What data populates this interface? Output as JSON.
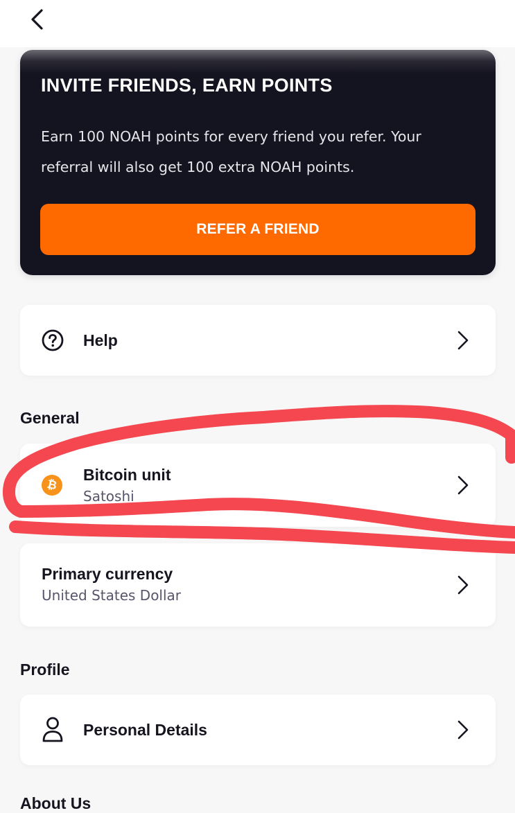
{
  "header": {
    "back_icon": "chevron-left-icon"
  },
  "promo": {
    "title": "INVITE FRIENDS, EARN POINTS",
    "body": "Earn 100 NOAH points for every friend you refer. Your referral will also get 100 extra NOAH points.",
    "button_label": "REFER A FRIEND",
    "accent_color": "#ff6a00",
    "background_color": "#141320"
  },
  "help": {
    "icon": "question-circle-icon",
    "label": "Help"
  },
  "general": {
    "title": "General",
    "bitcoin_unit": {
      "icon": "bitcoin-icon",
      "label": "Bitcoin unit",
      "value": "Satoshi"
    },
    "primary_currency": {
      "label": "Primary currency",
      "value": "United States Dollar"
    }
  },
  "profile": {
    "title": "Profile",
    "personal_details": {
      "icon": "user-icon",
      "label": "Personal Details"
    }
  },
  "about": {
    "title": "About Us"
  },
  "annotation": {
    "color": "#f4474f"
  }
}
